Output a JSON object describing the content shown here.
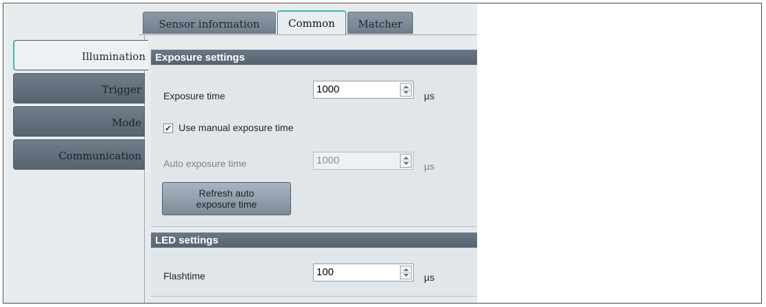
{
  "tabs": [
    "Sensor information",
    "Common",
    "Matcher"
  ],
  "active_tab": "Common",
  "nav": [
    "Illumination",
    "Trigger",
    "Mode",
    "Communication"
  ],
  "active_nav": "Illumination",
  "exposure": {
    "title": "Exposure settings",
    "exposure_time_label": "Exposure time",
    "exposure_time_value": "1000",
    "exposure_unit": "µs",
    "manual_checkbox_label": "Use manual exposure time",
    "manual_checked": true,
    "auto_label": "Auto exposure time",
    "auto_value": "1000",
    "auto_unit": "µs",
    "refresh_line1": "Refresh auto",
    "refresh_line2": "exposure time"
  },
  "led": {
    "title": "LED settings",
    "flashtime_label": "Flashtime",
    "flashtime_value": "100",
    "flashtime_unit": "µs"
  },
  "colors": {
    "accent": "#39b7a6",
    "section_header": "#5f6b78",
    "nav_dark": "#5f6c79"
  }
}
